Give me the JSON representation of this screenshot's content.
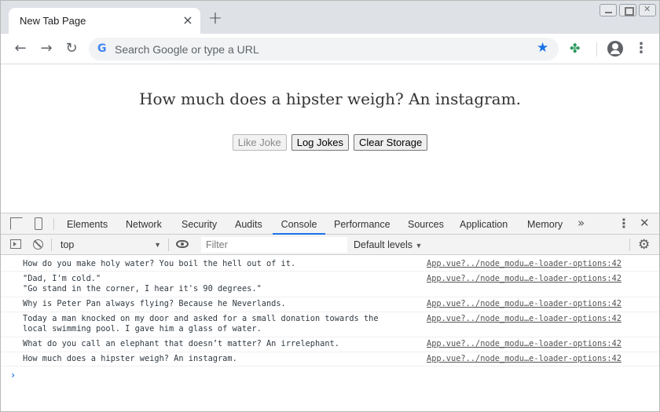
{
  "browser": {
    "tab_title": "New Tab Page",
    "new_tab_symbol": "+",
    "omnibox_placeholder": "Search Google or type a URL",
    "google_letter": "G"
  },
  "page": {
    "heading": "How much does a hipster weigh? An instagram.",
    "buttons": {
      "like": "Like Joke",
      "log": "Log Jokes",
      "clear": "Clear Storage"
    },
    "like_disabled": true
  },
  "devtools": {
    "tabs": [
      "Elements",
      "Network",
      "Security",
      "Audits",
      "Console",
      "Performance",
      "Sources",
      "Application",
      "Memory"
    ],
    "active_tab": "Console",
    "context": "top",
    "filter_placeholder": "Filter",
    "levels": "Default levels",
    "console_messages": [
      {
        "text": "How do you make holy water? You boil the hell out of it.",
        "source": "App.vue?../node_modu…e-loader-options:42"
      },
      {
        "text": "\"Dad, I'm cold.\"\n\"Go stand in the corner, I hear it's 90 degrees.\"",
        "source": "App.vue?../node_modu…e-loader-options:42"
      },
      {
        "text": "Why is Peter Pan always flying? Because he Neverlands.",
        "source": "App.vue?../node_modu…e-loader-options:42"
      },
      {
        "text": "Today a man knocked on my door and asked for a small donation towards the\nlocal swimming pool. I gave him a glass of water.",
        "source": "App.vue?../node_modu…e-loader-options:42"
      },
      {
        "text": "What do you call an elephant that doesn’t matter? An irrelephant.",
        "source": "App.vue?../node_modu…e-loader-options:42"
      },
      {
        "text": "How much does a hipster weigh? An instagram.",
        "source": "App.vue?../node_modu…e-loader-options:42"
      }
    ]
  },
  "colors": {
    "accent": "#1a73e8",
    "tabstrip": "#dee1e6",
    "devtools_bar": "#f3f3f3"
  }
}
